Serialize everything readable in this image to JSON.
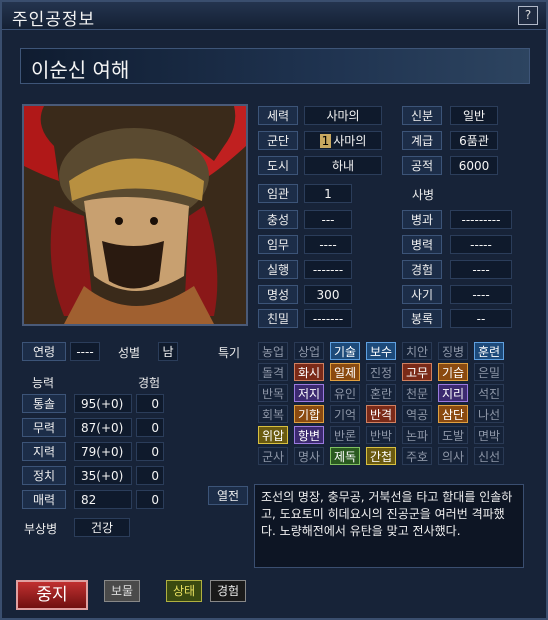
{
  "window": {
    "title": "주인공정보",
    "help_label": "?"
  },
  "hero": {
    "name": "이순신  여해"
  },
  "info": {
    "faction_label": "세력",
    "faction": "사마의",
    "status_label": "신분",
    "status": "일반",
    "corps_label": "군단",
    "corps_badge": "1",
    "corps": "사마의",
    "rank_label": "계급",
    "rank": "6품관",
    "city_label": "도시",
    "city": "하내",
    "merit_label": "공적",
    "merit": "6000",
    "appoint_label": "임관",
    "appoint": "1",
    "troops_header": "사병",
    "loyalty_label": "충성",
    "loyalty": "---",
    "branch_label": "병과",
    "branch": "---------",
    "duty_label": "임무",
    "duty": "----",
    "troop_power_label": "병력",
    "troop_power": "-----",
    "exec_label": "실행",
    "exec": "-------",
    "exp_label": "경험",
    "exp": "----",
    "fame_label": "명성",
    "fame": "300",
    "morale_label": "사기",
    "morale": "----",
    "intimacy_label": "친밀",
    "intimacy": "-------",
    "salary_label": "봉록",
    "salary": "--"
  },
  "personal": {
    "age_label": "연령",
    "age": "----",
    "gender_label": "성별",
    "gender": "남"
  },
  "abilities": {
    "header_ability": "능력",
    "header_exp": "경험",
    "rows": [
      {
        "label": "통솔",
        "value": "95(+0)",
        "exp": "0"
      },
      {
        "label": "무력",
        "value": "87(+0)",
        "exp": "0"
      },
      {
        "label": "지력",
        "value": "79(+0)",
        "exp": "0"
      },
      {
        "label": "정치",
        "value": "35(+0)",
        "exp": "0"
      },
      {
        "label": "매력",
        "value": "82",
        "exp": "0"
      }
    ],
    "injury_label": "부상병",
    "injury": "건강"
  },
  "skills": {
    "label": "특기",
    "rows": [
      [
        {
          "t": "농업",
          "c": "none"
        },
        {
          "t": "상업",
          "c": "none"
        },
        {
          "t": "기술",
          "c": "blue"
        },
        {
          "t": "보수",
          "c": "blue"
        },
        {
          "t": "치안",
          "c": "none"
        },
        {
          "t": "징병",
          "c": "none"
        },
        {
          "t": "훈련",
          "c": "blue"
        }
      ],
      [
        {
          "t": "돌격",
          "c": "none"
        },
        {
          "t": "화시",
          "c": "red"
        },
        {
          "t": "일제",
          "c": "orange"
        },
        {
          "t": "진정",
          "c": "none"
        },
        {
          "t": "고무",
          "c": "red"
        },
        {
          "t": "기습",
          "c": "orange"
        },
        {
          "t": "은밀",
          "c": "none"
        }
      ],
      [
        {
          "t": "반목",
          "c": "none"
        },
        {
          "t": "저지",
          "c": "purple"
        },
        {
          "t": "유인",
          "c": "none"
        },
        {
          "t": "혼란",
          "c": "none"
        },
        {
          "t": "천문",
          "c": "none"
        },
        {
          "t": "지리",
          "c": "purple"
        },
        {
          "t": "석진",
          "c": "none"
        }
      ],
      [
        {
          "t": "회복",
          "c": "none"
        },
        {
          "t": "기합",
          "c": "orange"
        },
        {
          "t": "기억",
          "c": "none"
        },
        {
          "t": "반격",
          "c": "red"
        },
        {
          "t": "역공",
          "c": "none"
        },
        {
          "t": "삼단",
          "c": "orange"
        },
        {
          "t": "나선",
          "c": "none"
        }
      ],
      [
        {
          "t": "위압",
          "c": "yellow"
        },
        {
          "t": "항변",
          "c": "purple"
        },
        {
          "t": "반론",
          "c": "none"
        },
        {
          "t": "반박",
          "c": "none"
        },
        {
          "t": "논파",
          "c": "none"
        },
        {
          "t": "도발",
          "c": "none"
        },
        {
          "t": "면박",
          "c": "none"
        }
      ],
      [
        {
          "t": "군사",
          "c": "none"
        },
        {
          "t": "명사",
          "c": "none"
        },
        {
          "t": "제독",
          "c": "green"
        },
        {
          "t": "간첩",
          "c": "yellow"
        },
        {
          "t": "주호",
          "c": "none"
        },
        {
          "t": "의사",
          "c": "none"
        },
        {
          "t": "신선",
          "c": "none"
        }
      ]
    ]
  },
  "bio": {
    "label": "열전",
    "text": "조선의 명장, 충무공, 거북선을 타고 함대를 인솔하고, 도요토미 히데요시의 진공군을 여러번 격파했다. 노량해전에서 유탄을 맞고 전사했다."
  },
  "buttons": {
    "stop": "중지",
    "treasure": "보물",
    "status": "상태",
    "experience": "경험"
  },
  "colors": {
    "panel": "#172338",
    "label_bg": "#1c2d48",
    "accent_red": "#c03030"
  }
}
